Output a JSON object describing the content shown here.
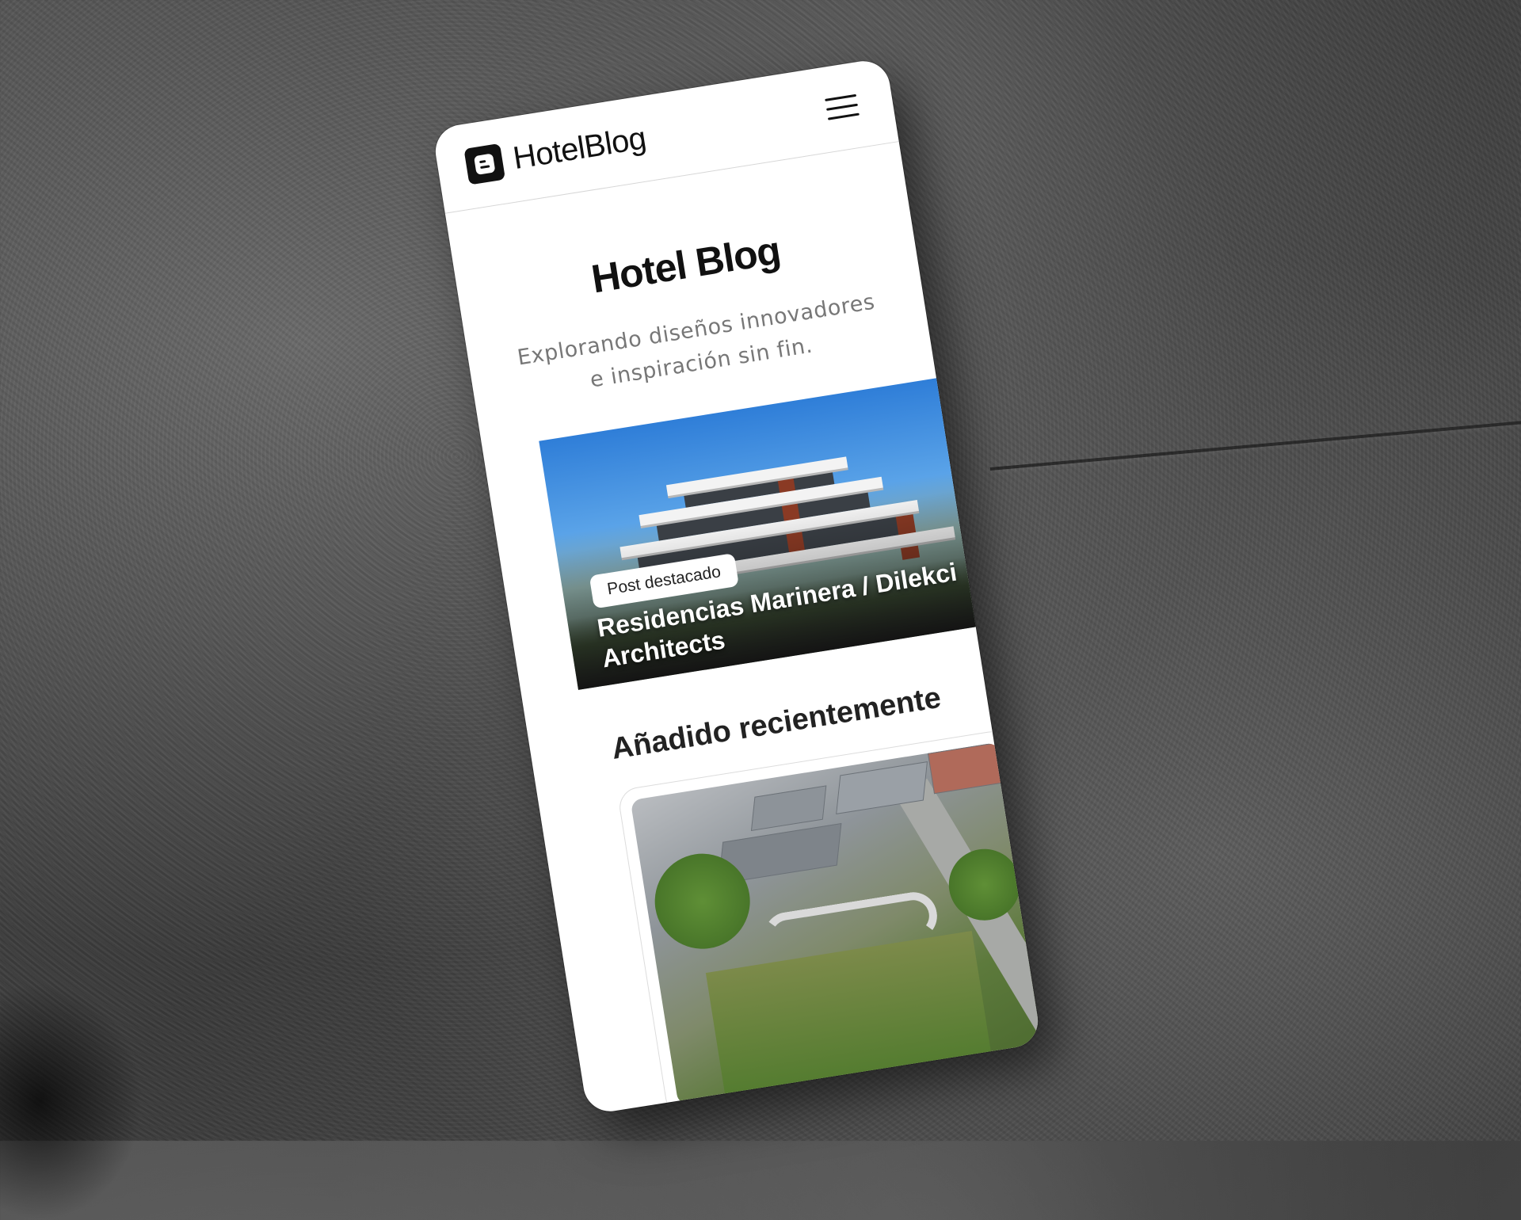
{
  "brand": {
    "name": "HotelBlog",
    "logo_icon": "blogger-b-icon"
  },
  "header": {
    "menu_icon": "hamburger-menu-icon"
  },
  "hero": {
    "title": "Hotel Blog",
    "subtitle": "Explorando diseños innovadores e inspiración sin fin."
  },
  "featured": {
    "badge": "Post destacado",
    "title": "Residencias Marinera / Dilekci Architects"
  },
  "recent": {
    "section_title": "Añadido recientemente"
  },
  "colors": {
    "background": "#444444",
    "surface": "#ffffff",
    "text_primary": "#111111",
    "text_secondary": "#777777"
  }
}
